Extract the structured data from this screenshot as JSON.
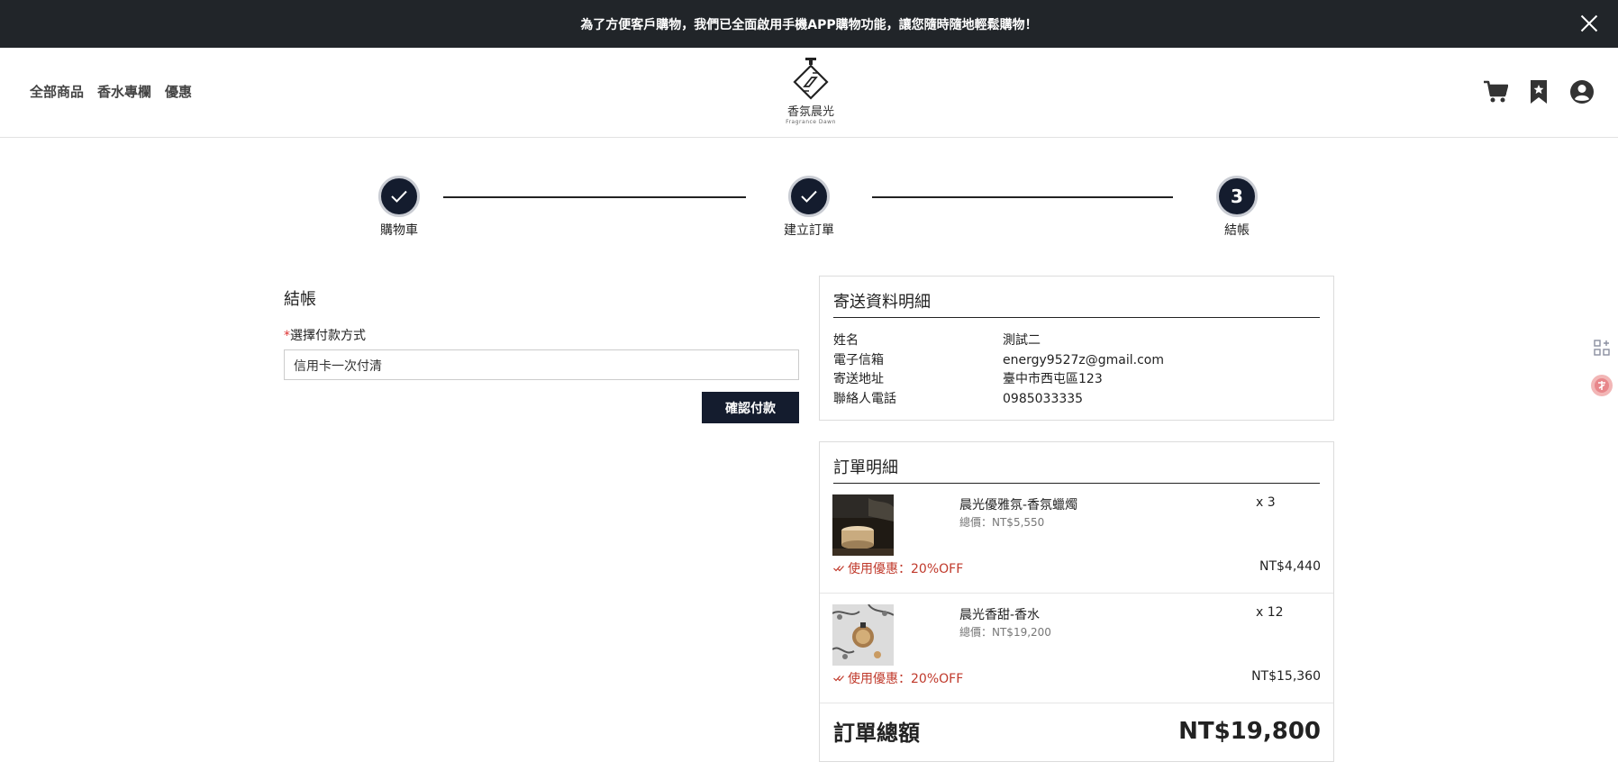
{
  "banner": {
    "text": "為了方便客戶購物，我們已全面啟用手機APP購物功能，讓您隨時隨地輕鬆購物！"
  },
  "nav": {
    "items": [
      "全部商品",
      "香水專欄",
      "優惠"
    ]
  },
  "logo": {
    "name": "香氛晨光",
    "sub": "Fragrance Dawn"
  },
  "header_icons": [
    "cart-icon",
    "bookmark-icon",
    "account-icon"
  ],
  "stepper": {
    "steps": [
      {
        "label": "購物車",
        "state": "done"
      },
      {
        "label": "建立訂單",
        "state": "done"
      },
      {
        "label": "結帳",
        "state": "current",
        "number": "3"
      }
    ]
  },
  "checkout": {
    "title": "結帳",
    "payment_label": "選擇付款方式",
    "required_mark": "*",
    "payment_value": "信用卡一次付清",
    "confirm_label": "確認付款"
  },
  "shipping": {
    "title": "寄送資料明細",
    "rows": [
      {
        "key": "姓名",
        "value": "測試二"
      },
      {
        "key": "電子信箱",
        "value": "energy9527z@gmail.com"
      },
      {
        "key": "寄送地址",
        "value": "臺中市西屯區123"
      },
      {
        "key": "聯絡人電話",
        "value": "0985033335"
      }
    ]
  },
  "order": {
    "title": "訂單明細",
    "items": [
      {
        "name": "晨光優雅氛-香氛蠟燭",
        "total": "總價：NT$5,550",
        "qty": "x 3",
        "discount": "使用優惠：20%OFF",
        "price": "NT$4,440"
      },
      {
        "name": "晨光香甜-香水",
        "total": "總價：NT$19,200",
        "qty": "x 12",
        "discount": "使用優惠：20%OFF",
        "price": "NT$15,360"
      }
    ],
    "total_label": "訂單總額",
    "total_amount": "NT$19,800"
  },
  "colors": {
    "dark": "#141c2e",
    "discount": "#c0392b",
    "banner": "#212529"
  }
}
